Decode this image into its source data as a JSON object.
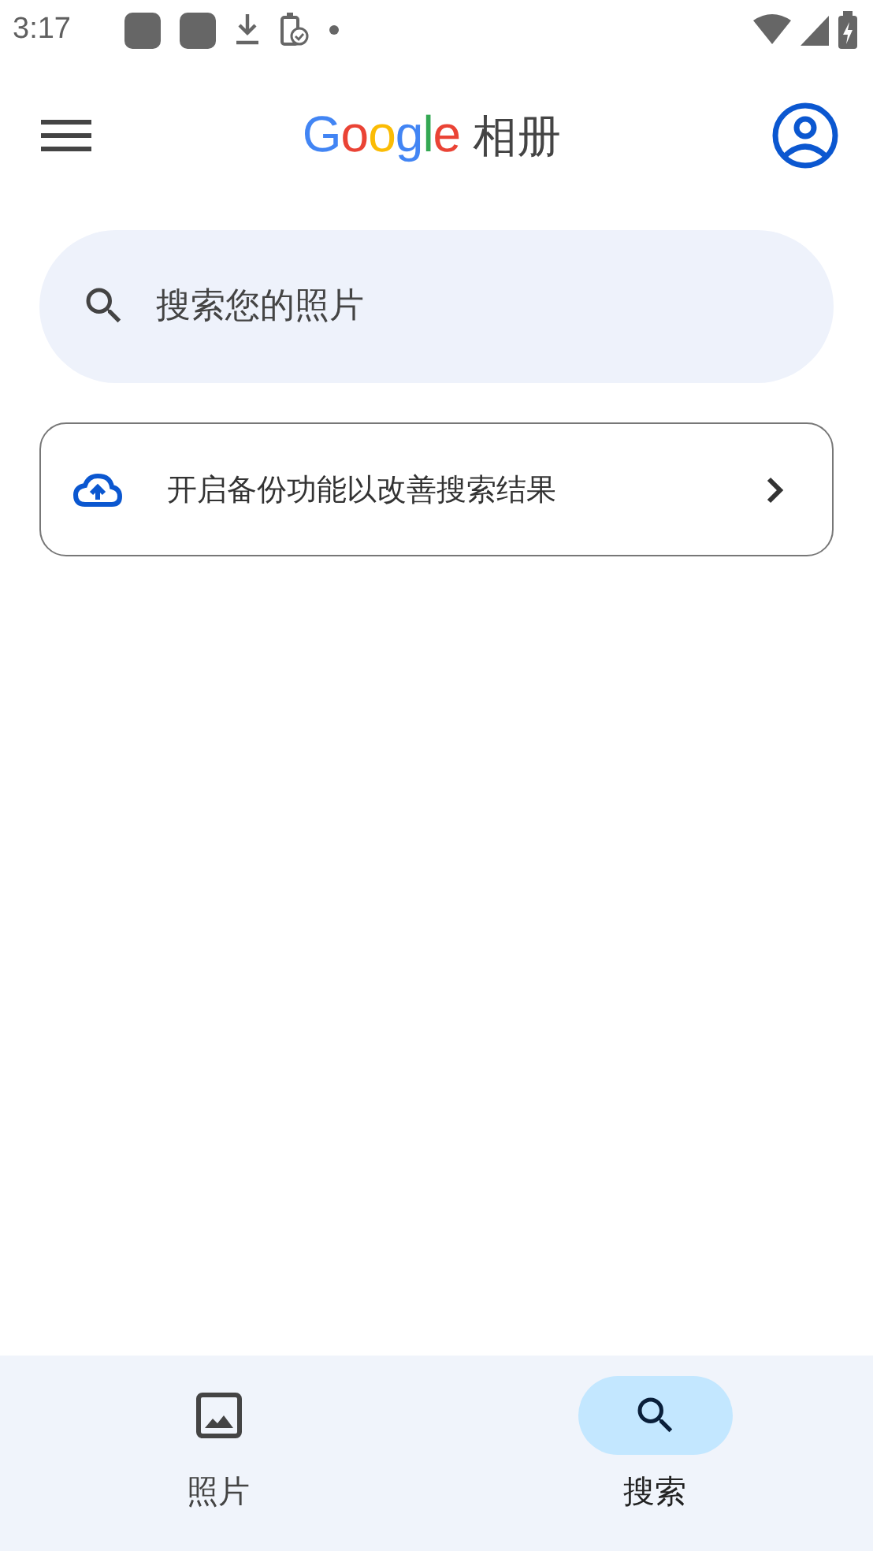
{
  "status_bar": {
    "time": "3:17"
  },
  "app_bar": {
    "logo_word": "Google",
    "title": "相册"
  },
  "search": {
    "placeholder": "搜索您的照片"
  },
  "backup_card": {
    "text": "开启备份功能以改善搜索结果"
  },
  "bottom_nav": [
    {
      "label": "照片",
      "kind": "photos",
      "selected": false
    },
    {
      "label": "搜索",
      "kind": "search",
      "selected": true
    }
  ]
}
